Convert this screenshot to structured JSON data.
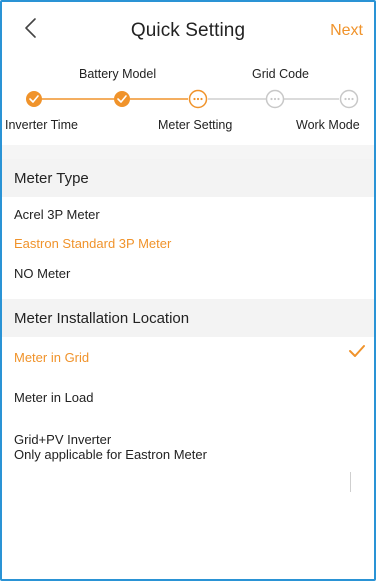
{
  "header": {
    "title": "Quick Setting",
    "next_label": "Next"
  },
  "steps": {
    "upper_labels": [
      "Battery Model",
      "Grid Code"
    ],
    "lower_labels": [
      "Inverter Time",
      "Meter Setting",
      "Work Mode"
    ],
    "states": [
      "done",
      "done",
      "current",
      "pending",
      "pending"
    ]
  },
  "meter_type": {
    "heading": "Meter Type",
    "options": [
      "Acrel 3P Meter",
      "Eastron Standard 3P Meter",
      "NO Meter"
    ],
    "selected": "Eastron Standard 3P Meter"
  },
  "meter_location": {
    "heading": "Meter Installation Location",
    "options": [
      "Meter in Grid",
      "Meter in Load"
    ],
    "option3_line1": "Grid+PV Inverter",
    "option3_line2": "Only applicable for Eastron Meter",
    "selected": "Meter in Grid"
  },
  "colors": {
    "accent": "#f0932b",
    "frame": "#2a93d5",
    "pending": "#c8c8c8"
  }
}
